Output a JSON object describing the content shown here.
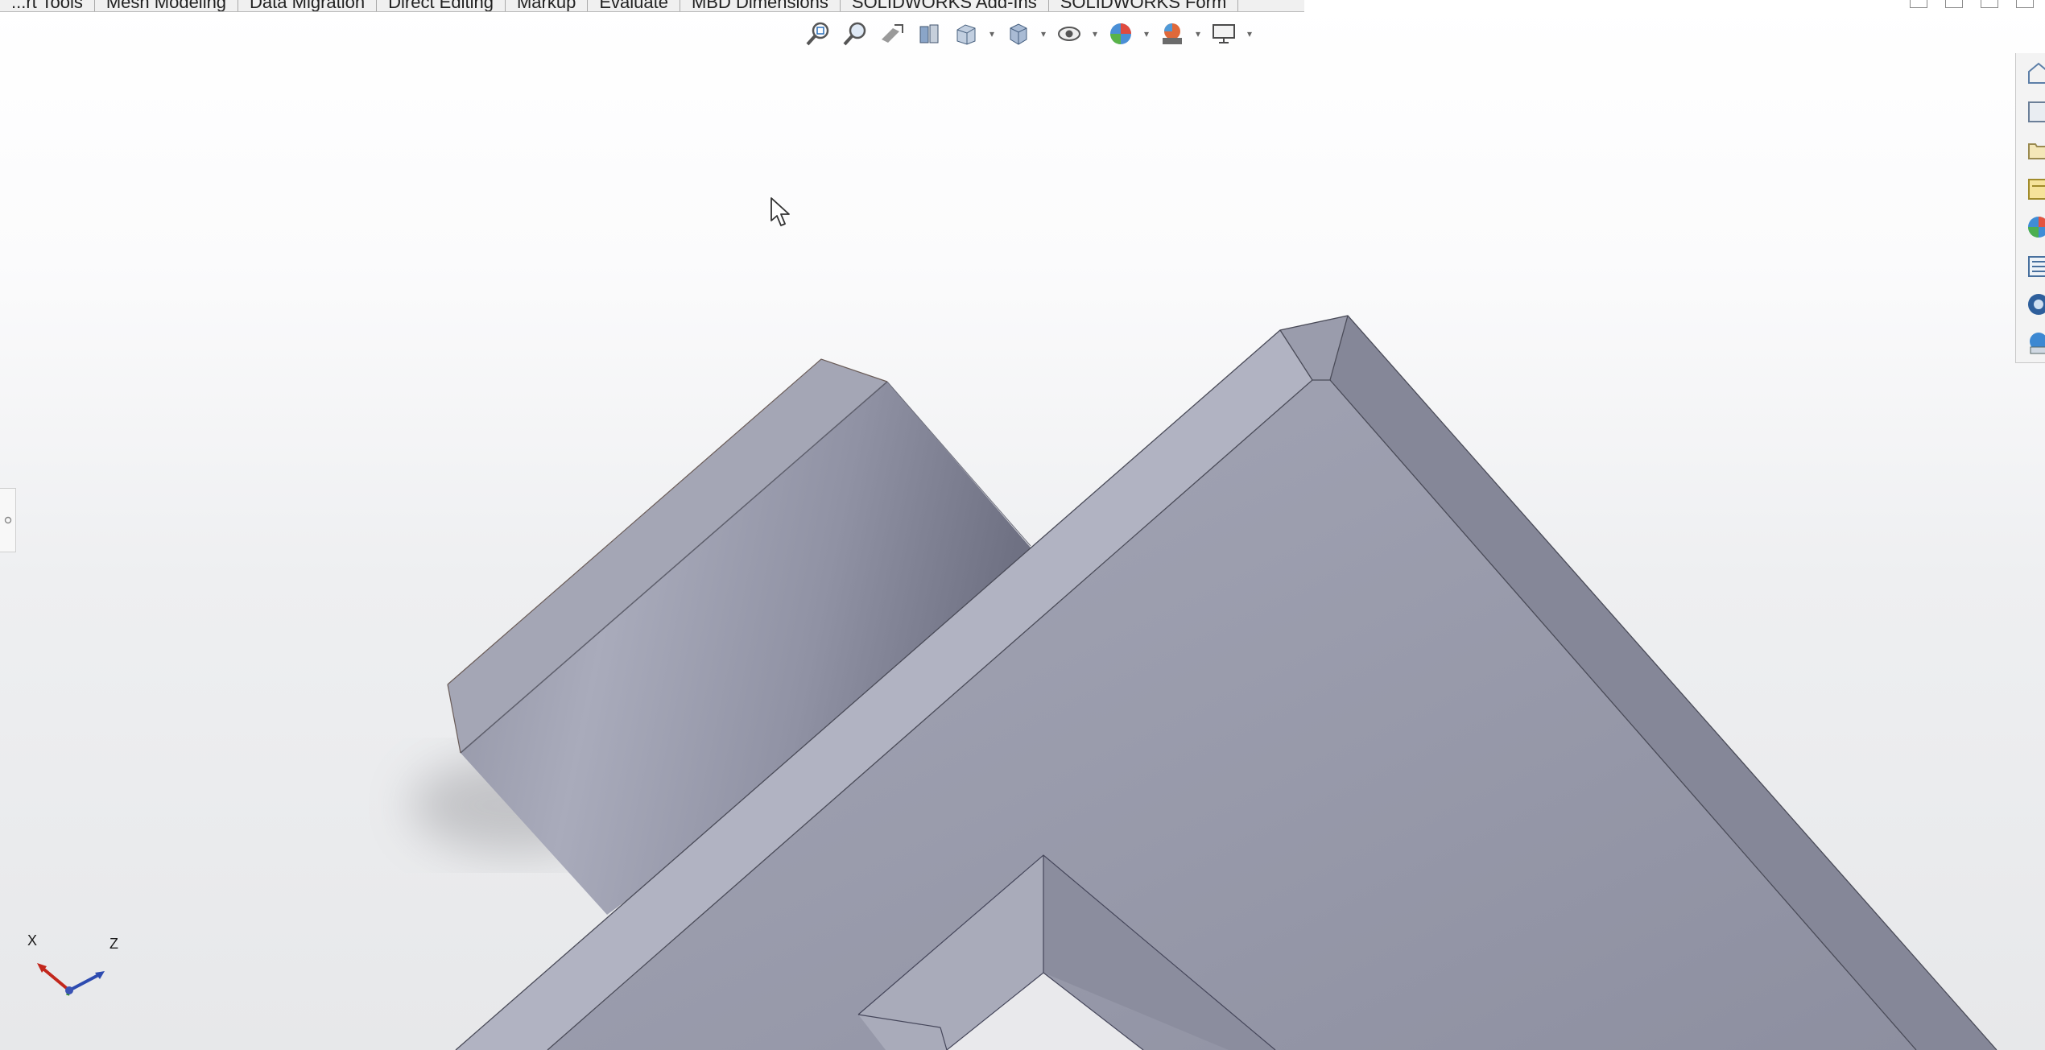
{
  "tabs": [
    {
      "label": "...rt Tools"
    },
    {
      "label": "Mesh Modeling"
    },
    {
      "label": "Data Migration"
    },
    {
      "label": "Direct Editing"
    },
    {
      "label": "Markup"
    },
    {
      "label": "Evaluate"
    },
    {
      "label": "MBD Dimensions"
    },
    {
      "label": "SOLIDWORKS Add-Ins"
    },
    {
      "label": "SOLIDWORKS Form"
    }
  ],
  "view_toolbar": [
    {
      "icon": "zoom-to-fit-icon"
    },
    {
      "icon": "zoom-to-area-icon"
    },
    {
      "icon": "previous-view-icon"
    },
    {
      "icon": "section-view-icon"
    },
    {
      "icon": "view-orientation-icon"
    },
    {
      "icon": "display-style-icon"
    },
    {
      "icon": "hide-show-items-icon"
    },
    {
      "icon": "edit-appearance-icon"
    },
    {
      "icon": "apply-scene-icon"
    },
    {
      "icon": "view-settings-icon"
    }
  ],
  "task_pane": [
    {
      "icon": "solidworks-resources-icon"
    },
    {
      "icon": "design-library-icon"
    },
    {
      "icon": "file-explorer-icon"
    },
    {
      "icon": "search-results-icon"
    },
    {
      "icon": "view-palette-icon"
    },
    {
      "icon": "appearances-scenes-icon"
    },
    {
      "icon": "custom-properties-icon"
    },
    {
      "icon": "solidworks-forum-icon"
    }
  ],
  "triad": {
    "x_label": "X",
    "z_label": "Z"
  },
  "colors": {
    "model_face": "#9fa1b1",
    "model_dark": "#868899",
    "model_light": "#b4b6c4",
    "background_top": "#ffffff",
    "background_bottom": "#e7e8ea"
  }
}
